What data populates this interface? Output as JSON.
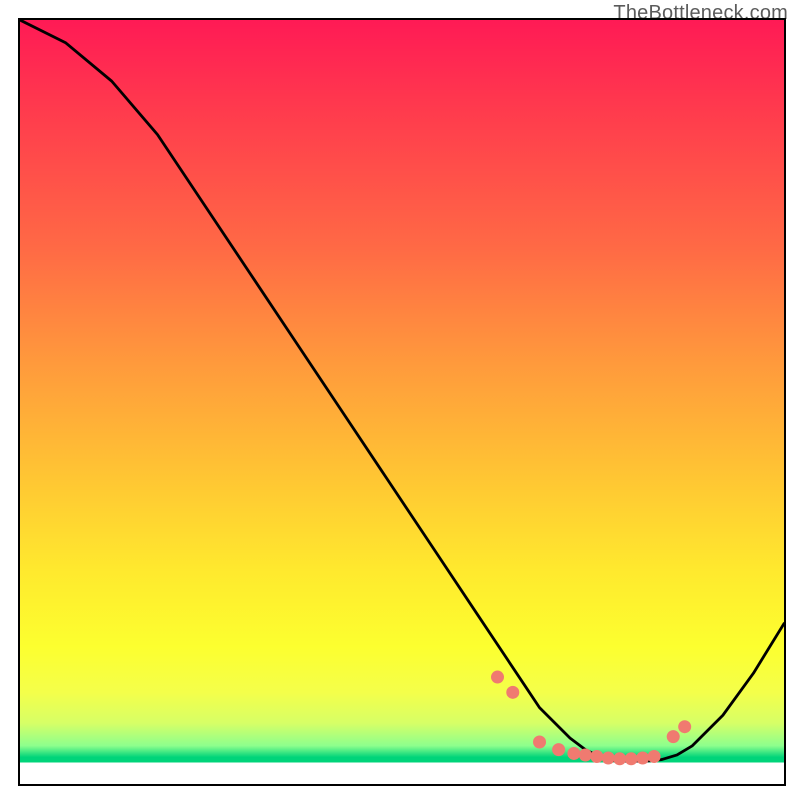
{
  "watermark": "TheBottleneck.com",
  "chart_data": {
    "type": "line",
    "title": "",
    "xlabel": "",
    "ylabel": "",
    "xlim": [
      0,
      100
    ],
    "ylim": [
      0,
      100
    ],
    "grid": false,
    "series": [
      {
        "name": "curve",
        "x": [
          0,
          6,
          12,
          18,
          24,
          30,
          36,
          42,
          48,
          54,
          60,
          64,
          66,
          68,
          70,
          72,
          74,
          76,
          78,
          80,
          82,
          84,
          86,
          88,
          92,
          96,
          100
        ],
        "y": [
          100,
          97,
          92,
          85,
          76,
          67,
          58,
          49,
          40,
          31,
          22,
          16,
          13,
          10,
          8,
          6,
          4.5,
          3.5,
          3.0,
          3.0,
          3.0,
          3.2,
          3.8,
          5.0,
          9.0,
          14.5,
          21
        ]
      }
    ],
    "markers": {
      "name": "dots",
      "color": "#f07a70",
      "x": [
        62.5,
        64.5,
        68.0,
        70.5,
        72.5,
        74.0,
        75.5,
        77.0,
        78.5,
        80.0,
        81.5,
        83.0,
        85.5,
        87.0
      ],
      "y": [
        14.0,
        12.0,
        5.5,
        4.5,
        4.0,
        3.8,
        3.6,
        3.4,
        3.3,
        3.3,
        3.4,
        3.6,
        6.2,
        7.5
      ]
    },
    "background_gradient": {
      "direction": "vertical",
      "stops": [
        {
          "pos": 0.0,
          "color": "#ff1a55"
        },
        {
          "pos": 0.3,
          "color": "#ff6a45"
        },
        {
          "pos": 0.6,
          "color": "#ffc633"
        },
        {
          "pos": 0.82,
          "color": "#fcff2f"
        },
        {
          "pos": 0.93,
          "color": "#aaff77"
        },
        {
          "pos": 0.965,
          "color": "#00d47a"
        },
        {
          "pos": 0.972,
          "color": "#ffffff"
        },
        {
          "pos": 1.0,
          "color": "#ffffff"
        }
      ]
    }
  }
}
